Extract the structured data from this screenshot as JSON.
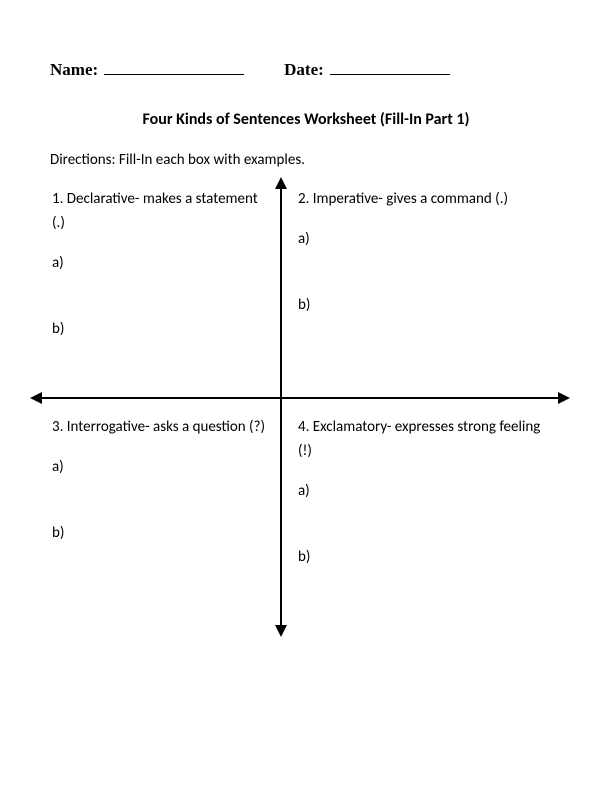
{
  "header": {
    "name_label": "Name:",
    "date_label": "Date:"
  },
  "title": "Four Kinds of Sentences Worksheet (Fill-In Part 1)",
  "directions": "Directions: Fill-In each box with examples.",
  "quadrants": {
    "q1": {
      "desc": "1. Declarative- makes a statement (.)",
      "a": "a)",
      "b": "b)"
    },
    "q2": {
      "desc": "2. Imperative- gives a command (.)",
      "a": "a)",
      "b": "b)"
    },
    "q3": {
      "desc": "3. Interrogative- asks a question (?)",
      "a": "a)",
      "b": "b)"
    },
    "q4": {
      "desc": "4. Exclamatory- expresses strong feeling (!)",
      "a": "a)",
      "b": "b)"
    }
  }
}
